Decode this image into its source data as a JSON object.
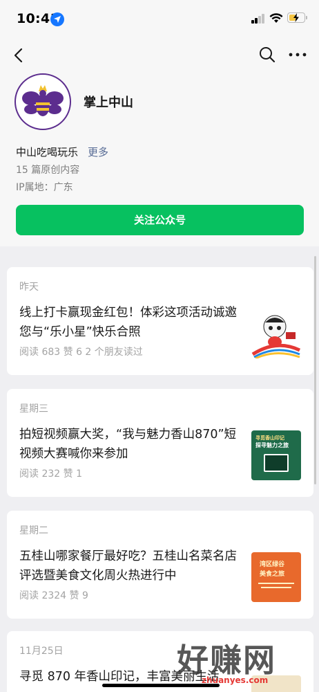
{
  "status_bar": {
    "time": "10:41"
  },
  "profile": {
    "account_name": "掌上中山",
    "description": "中山吃喝玩乐",
    "more_link": "更多",
    "original_count": "15 篇原创内容",
    "ip_location": "IP属地：广东",
    "follow_label": "关注公众号"
  },
  "articles": [
    {
      "date": "昨天",
      "title": "线上打卡赢现金红包！体彩这项活动诚邀您与“乐小星”快乐合照",
      "meta": "阅读 683   赞 6   2 个朋友读过"
    },
    {
      "date": "星期三",
      "title": "拍短视频赢大奖，“我与魅力香山870”短视频大赛喊你来参加",
      "meta": "阅读 232   赞 1"
    },
    {
      "date": "星期二",
      "title": "五桂山哪家餐厅最好吃？五桂山名菜名店评选暨美食文化周火热进行中",
      "meta": "阅读 2324   赞 9"
    },
    {
      "date": "11月25日",
      "title": "寻觅 870 年香山印记，丰富美丽生活",
      "meta": ""
    }
  ],
  "thumb_text": {
    "t2_line1": "寻觅香山印记",
    "t2_line2": "探寻魅力之旅",
    "t3_line1": "湾区绿谷",
    "t3_line2": "美食之旅"
  },
  "watermark": {
    "text": "好赚网",
    "url": "zhuanyes.com"
  },
  "colors": {
    "accent_green": "#07c160",
    "link_blue": "#576b95",
    "avatar_purple": "#5c2d8e"
  }
}
